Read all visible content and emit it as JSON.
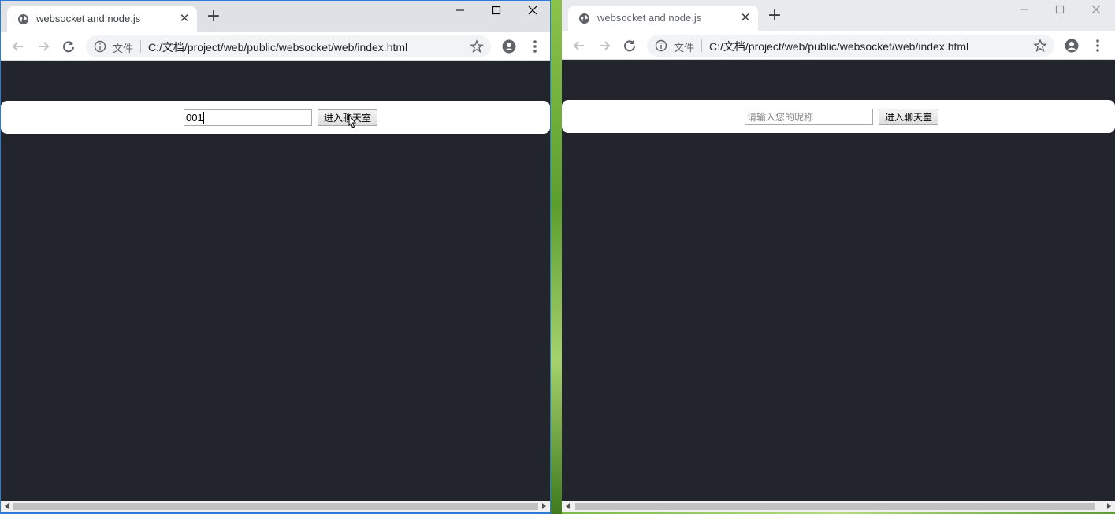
{
  "windows": [
    {
      "tab_title": "websocket and node.js",
      "omnibox": {
        "security_label": "文件",
        "url": "C:/文档/project/web/public/websocket/web/index.html"
      },
      "login": {
        "input_value": "001",
        "input_placeholder": "请输入您的昵称",
        "button_label": "进入聊天室"
      }
    },
    {
      "tab_title": "websocket and node.js",
      "omnibox": {
        "security_label": "文件",
        "url": "C:/文档/project/web/public/websocket/web/index.html"
      },
      "login": {
        "input_value": "",
        "input_placeholder": "请输入您的昵称",
        "button_label": "进入聊天室"
      }
    }
  ],
  "icons": {
    "tab_favicon": "globe-icon",
    "tab_close": "close-icon",
    "new_tab": "plus-icon",
    "back": "arrow-left-icon",
    "forward": "arrow-right-icon",
    "reload": "reload-icon",
    "site_info": "info-icon",
    "bookmark": "star-icon",
    "profile": "account-circle-icon",
    "menu": "more-vert-icon",
    "minimize": "minimize-icon",
    "maximize": "maximize-icon",
    "close_window": "close-window-icon"
  },
  "colors": {
    "page_background": "#22252b",
    "tabstrip_active": "#dee1e6",
    "tabstrip_inactive": "#e8eaed",
    "active_window_border": "#2b7bd6"
  }
}
